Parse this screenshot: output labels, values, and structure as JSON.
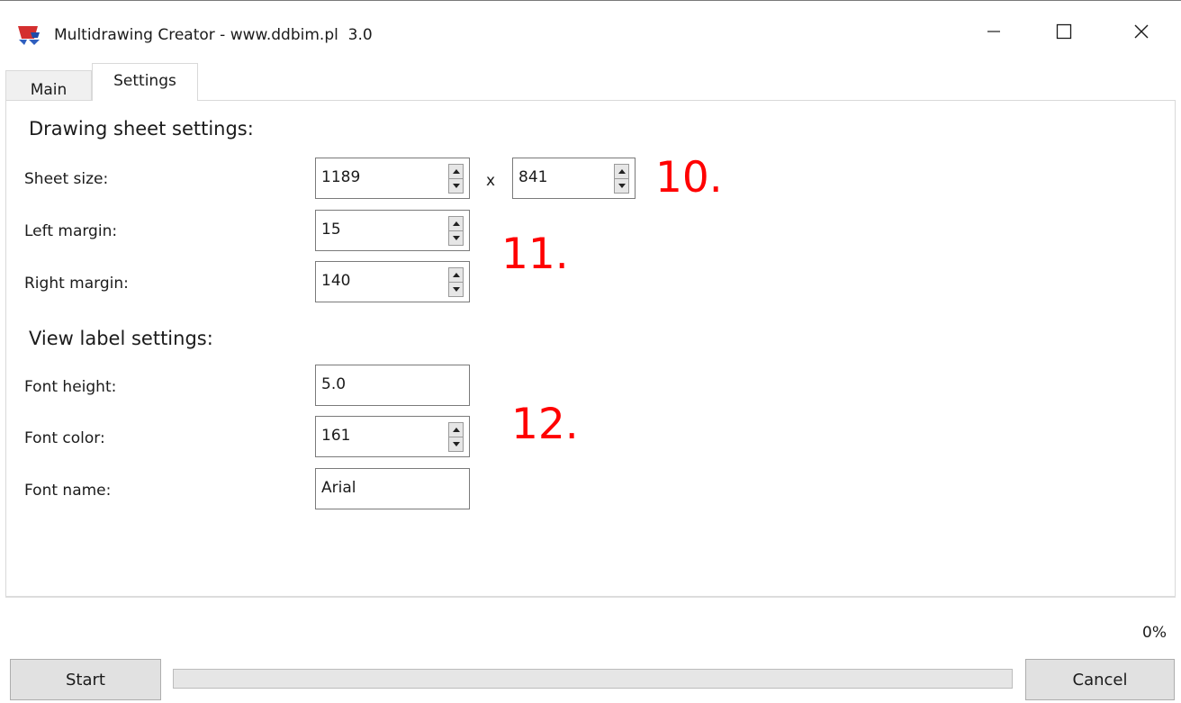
{
  "window": {
    "title": "Multidrawing Creator - www.ddbim.pl  3.0",
    "icon": "app-logo-icon",
    "controls": [
      "minimize-icon",
      "maximize-icon",
      "close-icon"
    ]
  },
  "tabs": [
    {
      "label": "Main",
      "active": false
    },
    {
      "label": "Settings",
      "active": true
    }
  ],
  "drawing_sheet": {
    "title": "Drawing sheet settings:",
    "sheet_size_label": "Sheet size:",
    "sheet_width": "1189",
    "times_sign": "x",
    "sheet_height": "841",
    "left_margin_label": "Left margin:",
    "left_margin": "15",
    "right_margin_label": "Right margin:",
    "right_margin": "140"
  },
  "view_label": {
    "title": "View label settings:",
    "font_height_label": "Font height:",
    "font_height": "5.0",
    "font_color_label": "Font color:",
    "font_color": "161",
    "font_name_label": "Font name:",
    "font_name": "Arial"
  },
  "annotations": {
    "a10": "10.",
    "a11": "11.",
    "a12": "12."
  },
  "footer": {
    "progress_text": "0%",
    "progress_value": 0,
    "start_label": "Start",
    "cancel_label": "Cancel"
  },
  "colors": {
    "annotation": "#ff0000",
    "progress_fill": "#06b025",
    "button_bg": "#e1e1e1"
  }
}
